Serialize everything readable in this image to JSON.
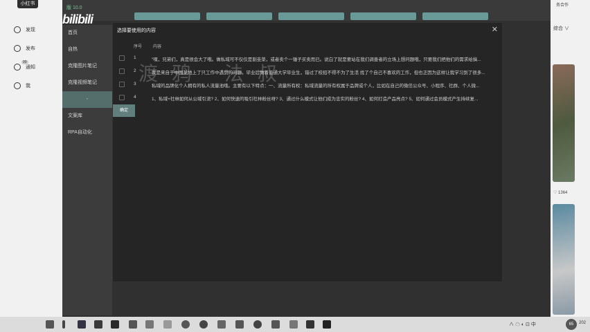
{
  "left_app": {
    "brand": "小红书",
    "nav": [
      {
        "label": "发现",
        "icon": "home-icon"
      },
      {
        "label": "发布",
        "icon": "plus-icon"
      },
      {
        "label": "通知",
        "icon": "bell-icon",
        "badge": "99"
      },
      {
        "label": "我",
        "icon": "user-icon"
      }
    ]
  },
  "right_app": {
    "top_text": "务合作",
    "sort": "综合 ∨",
    "likes": "♡ 1364"
  },
  "app": {
    "version": "版 10.0",
    "logo": "bilibili",
    "nav": [
      {
        "label": "首页"
      },
      {
        "label": "自热"
      },
      {
        "label": "克隆图片笔记"
      },
      {
        "label": "克隆视频笔记"
      },
      {
        "label": "-"
      },
      {
        "label": "文案库"
      },
      {
        "label": "RPA自动化"
      }
    ]
  },
  "modal": {
    "title": "选择要使用的内容",
    "close": "✕",
    "columns": {
      "no": "序号",
      "content": "内容"
    },
    "rows": [
      {
        "no": "1",
        "text": "\"嘿，兄弟们，真是很会大了哦。做私域可不仅仅是割韭菜，或者卖个一锤子买卖而已。说白了就是要站在我们调查者的立场上想问题哦，只要我们把他们的需求给搞..."
      },
      {
        "no": "2",
        "text": "我是来自于中国某地上了只工作中遇到的问题，毕业后做着普通大学毕业生，错过了校招不得不为了生活 找了个自己不喜欢的工作，但也正因为这样让我学习到了很多..."
      },
      {
        "no": "3",
        "text": "私域的品牌化个人拥有的私人流量池哦。主要有以下特点：一、流量所有权：私域流量的所有权属于品牌或个人，比如在自己的微信公众号、小程序、社群、个人微..."
      },
      {
        "no": "4",
        "text": "1、私域+社林如何从公域引流? 2、如何快速的吸引社林粉丝呀? 3、通过什么模式让他们成为忠实的粉丝? 4、如何打造产品亮点? 5、如何通过会员模式产生持续复..."
      }
    ],
    "confirm": "确定"
  },
  "watermark": "渡鸦 法叔",
  "taskbar": {
    "tray": "∧ ☁ ◐ ⊡ 中",
    "avatar": "65",
    "year": "202"
  }
}
